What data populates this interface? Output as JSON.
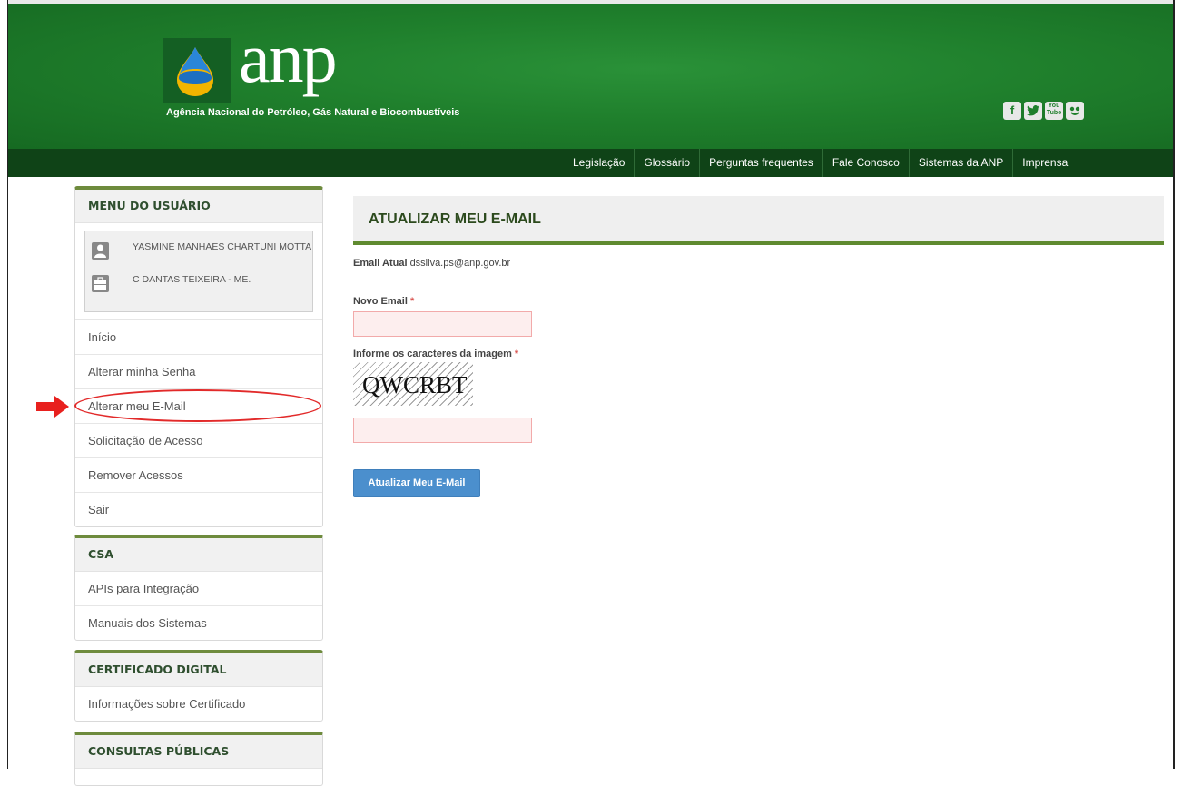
{
  "header": {
    "logo_text": "anp",
    "agency_name": "Agência Nacional do Petróleo, Gás Natural e Biocombustíveis",
    "social_icons": [
      "facebook-icon",
      "twitter-icon",
      "youtube-icon",
      "flickr-icon"
    ],
    "youtube_label_top": "You",
    "youtube_label_bottom": "Tube"
  },
  "topnav": {
    "items": [
      "Legislação",
      "Glossário",
      "Perguntas frequentes",
      "Fale Conosco",
      "Sistemas da ANP",
      "Imprensa"
    ]
  },
  "sidebar": {
    "user_menu": {
      "title": "MENU DO USUÁRIO",
      "user_name": "YASMINE MANHAES CHARTUNI MOTTA",
      "company": "C DANTAS TEIXEIRA - ME.",
      "items": [
        "Início",
        "Alterar minha Senha",
        "Alterar meu E-Mail",
        "Solicitação de Acesso",
        "Remover Acessos",
        "Sair"
      ]
    },
    "csa": {
      "title": "CSA",
      "items": [
        "APIs para Integração",
        "Manuais dos Sistemas"
      ]
    },
    "certificado": {
      "title": "CERTIFICADO DIGITAL",
      "items": [
        "Informações sobre Certificado"
      ]
    },
    "consultas": {
      "title": "CONSULTAS PÚBLICAS"
    }
  },
  "main": {
    "title": "ATUALIZAR MEU E-MAIL",
    "current_email_label": "Email Atual",
    "current_email_value": "dssilva.ps@anp.gov.br",
    "new_email_label": "Novo Email",
    "captcha_label": "Informe os caracteres da imagem",
    "required_mark": "*",
    "captcha_text": "QWCRBT",
    "submit_label": "Atualizar Meu E-Mail"
  },
  "colors": {
    "header_green": "#1f7f2c",
    "nav_dark_green": "#0f4317",
    "accent_green": "#5f8a2f",
    "button_blue": "#4b8fcd",
    "highlight_red": "#e22a2a"
  }
}
